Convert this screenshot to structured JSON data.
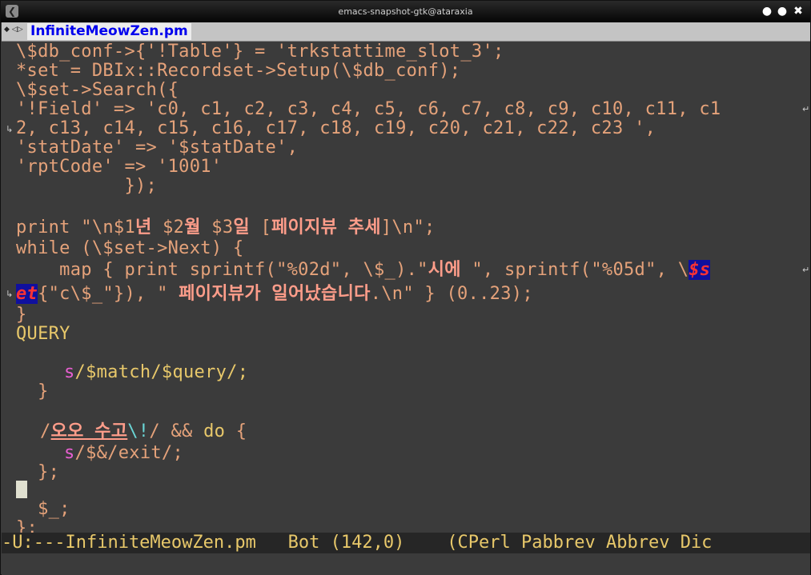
{
  "window": {
    "title": "emacs-snapshot-gtk@ataraxia",
    "icon": "emacs-app-icon",
    "buttons": {
      "menu": "●",
      "maximize": "●",
      "close": "✖"
    }
  },
  "tabbar": {
    "arrows": "◆ ◁▷",
    "active_tab": "InfiniteMeowZen.pm"
  },
  "code": {
    "line1": "\\$db_conf->{'!Table'} = 'trkstattime_slot_3';",
    "line2": "*set = DBIx::Recordset->Setup(\\$db_conf);",
    "line3": "\\$set->Search({",
    "line4": "'!Field' => 'c0, c1, c2, c3, c4, c5, c6, c7, c8, c9, c10, c11, c1",
    "line5": "2, c13, c14, c15, c16, c17, c18, c19, c20, c21, c22, c23 ',",
    "line6": "'statDate' => '$statDate',",
    "line7": "'rptCode' => '1001'",
    "line8": "          });",
    "line10_a": "print \"\\n$1",
    "line10_k1": "년",
    "line10_b": " $2",
    "line10_k2": "월",
    "line10_c": " $3",
    "line10_k3": "일",
    "line10_d": " [",
    "line10_k4": "페이지뷰 추세",
    "line10_e": "]\\n\";",
    "line11_kw": "while",
    "line11_rest": " (\\$set->Next) {",
    "line12_a": "    map { print sprintf(\"%02d\", \\$_).\"",
    "line12_k": "시에",
    "line12_b": " \", sprintf(\"%05d\", \\",
    "line12_hl": "$s",
    "line13_hl": "et",
    "line13_a": "{\"c\\$_\"}), \" ",
    "line13_k": "페이지뷰가 일어났습니다",
    "line13_b": ".\\n\" } (0..23);",
    "line14": "}",
    "line15": "QUERY",
    "line17_s": "s",
    "line17_rest": "/$match/$query/;",
    "line18": "  }",
    "line20_slash": "/",
    "line20_k": "오오 수고",
    "line20_esc": "\\!",
    "line20_mid": "/ && ",
    "line20_kw": "do",
    "line20_rest": " {",
    "line21_s": "s",
    "line21_rest": "/$&/exit/;",
    "line22": "  };",
    "line24": "  $_;",
    "line25": "};"
  },
  "modeline": {
    "text": "-U:---InfiniteMeowZen.pm   Bot (142,0)    (CPerl Pabbrev Abbrev Dic"
  },
  "colors": {
    "background": "#3b3b3b",
    "string": "#e5a27a",
    "keyword": "#e8c86a",
    "regex_op": "#e85fd1",
    "highlight_bg": "#10109e",
    "highlight_fg": "#ff3333"
  }
}
